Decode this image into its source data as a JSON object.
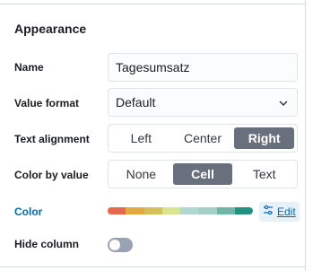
{
  "section": {
    "title": "Appearance"
  },
  "name": {
    "label": "Name",
    "value": "Tagesumsatz"
  },
  "value_format": {
    "label": "Value format",
    "selected": "Default",
    "icon": "chevron-down-icon"
  },
  "text_alignment": {
    "label": "Text alignment",
    "options": [
      "Left",
      "Center",
      "Right"
    ],
    "selected": "Right"
  },
  "color_by_value": {
    "label": "Color by value",
    "options": [
      "None",
      "Cell",
      "Text"
    ],
    "selected": "Cell"
  },
  "color": {
    "label": "Color",
    "palette": [
      "#e7664c",
      "#e4a93a",
      "#d6bf57",
      "#d9e48b",
      "#b0d8d3",
      "#a3d1c8",
      "#6db7a4",
      "#209280"
    ],
    "edit_label": "Edit",
    "edit_icon": "sliders-icon"
  },
  "hide_column": {
    "label": "Hide column",
    "enabled": false
  },
  "colors": {
    "accent": "#006bb8",
    "selected_segment": "#69707d",
    "border": "#d3dae6"
  }
}
